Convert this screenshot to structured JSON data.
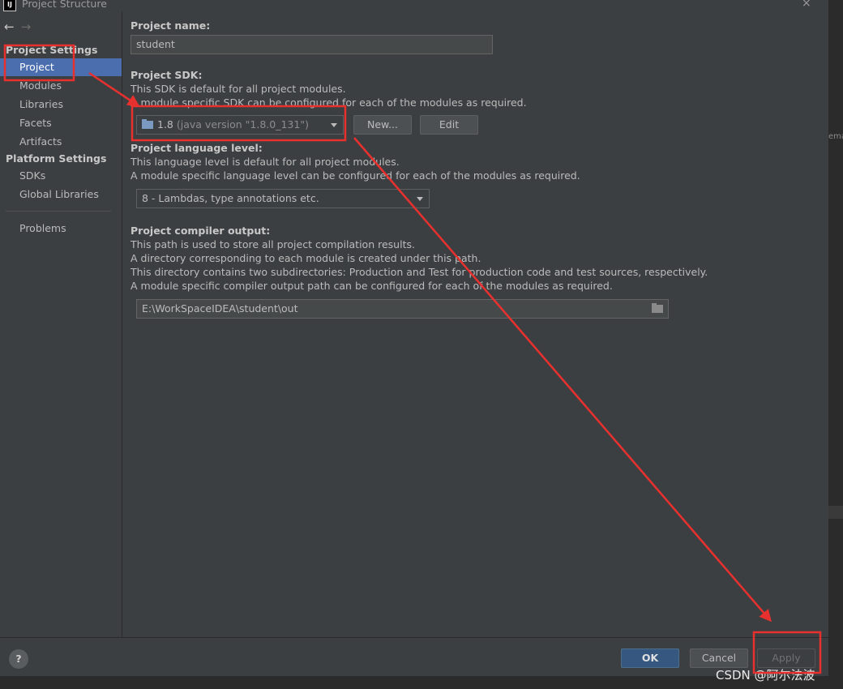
{
  "window": {
    "app_icon_text": "IJ",
    "title": "Project Structure",
    "close_glyph": "×"
  },
  "nav": {
    "back": "←",
    "forward": "→"
  },
  "sidebar": {
    "project_settings_header": "Project Settings",
    "project_items": [
      "Project",
      "Modules",
      "Libraries",
      "Facets",
      "Artifacts"
    ],
    "platform_settings_header": "Platform Settings",
    "platform_items": [
      "SDKs",
      "Global Libraries"
    ],
    "problems": "Problems",
    "selected": "Project"
  },
  "project": {
    "name_label": "Project name:",
    "name_value": "student",
    "sdk_label": "Project SDK:",
    "sdk_desc1": "This SDK is default for all project modules.",
    "sdk_desc2": "A module specific SDK can be configured for each of the modules as required.",
    "sdk_version": "1.8",
    "sdk_detail": "(java version \"1.8.0_131\")",
    "new_btn": "New...",
    "edit_btn": "Edit",
    "lang_label": "Project language level:",
    "lang_desc1": "This language level is default for all project modules.",
    "lang_desc2": "A module specific language level can be configured for each of the modules as required.",
    "lang_value": "8 - Lambdas, type annotations etc.",
    "output_label": "Project compiler output:",
    "output_desc1": "This path is used to store all project compilation results.",
    "output_desc2": "A directory corresponding to each module is created under this path.",
    "output_desc3": "This directory contains two subdirectories: Production and Test for production code and test sources, respectively.",
    "output_desc4": "A module specific compiler output path can be configured for each of the modules as required.",
    "output_value": "E:\\WorkSpaceIDEA\\student\\out"
  },
  "footer": {
    "help": "?",
    "ok": "OK",
    "cancel": "Cancel",
    "apply": "Apply"
  },
  "right_hint": "ema",
  "watermark": "CSDN @阿尔法波",
  "colors": {
    "annotation": "#e8312f",
    "selection": "#4b6eaf",
    "ok_button": "#365880"
  }
}
